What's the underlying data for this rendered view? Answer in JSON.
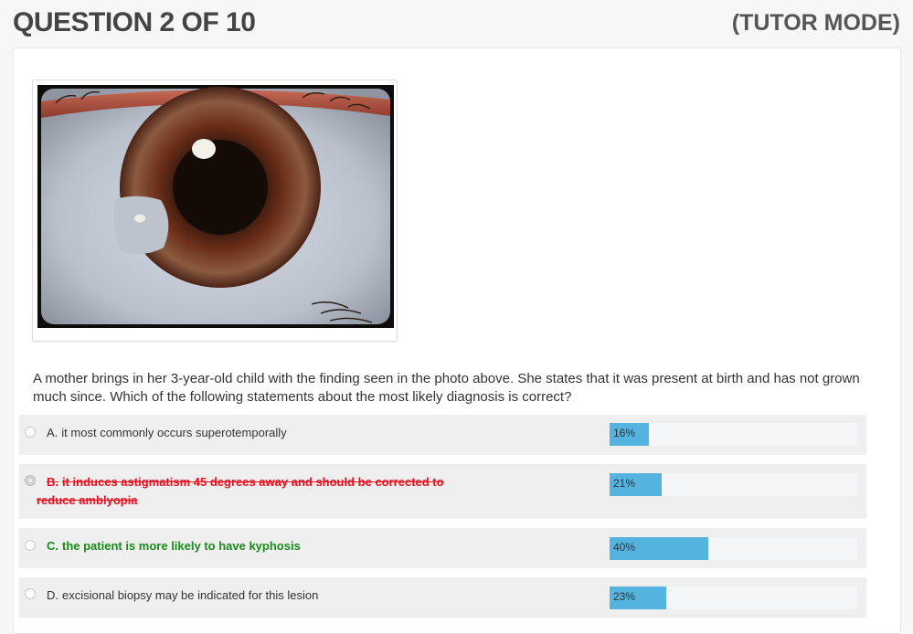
{
  "header": {
    "question_label": "QUESTION 2 OF 10",
    "mode_label": "(TUTOR MODE)"
  },
  "question": {
    "stem": "A mother brings in her 3-year-old child with the finding seen in the photo above. She states that it was present at birth and has not grown much since. Which of the following statements about the most likely diagnosis is correct?"
  },
  "answers": [
    {
      "letter": "A.",
      "text": "it most commonly occurs superotemporally",
      "percent_label": "16%",
      "percent": 16,
      "state": "normal",
      "selected": false
    },
    {
      "letter": "B.",
      "text": "it induces astigmatism 45 degrees away and should be corrected to reduce amblyopia",
      "percent_label": "21%",
      "percent": 21,
      "state": "incorrect",
      "selected": true
    },
    {
      "letter": "C.",
      "text": "the patient is more likely to have kyphosis",
      "percent_label": "40%",
      "percent": 40,
      "state": "correct",
      "selected": false
    },
    {
      "letter": "D.",
      "text": "excisional biopsy may be indicated for this lesion",
      "percent_label": "23%",
      "percent": 23,
      "state": "normal",
      "selected": false
    }
  ],
  "colors": {
    "bar_fill": "#55b3df",
    "incorrect_text": "#e8101f",
    "correct_text": "#1a8a1a"
  }
}
